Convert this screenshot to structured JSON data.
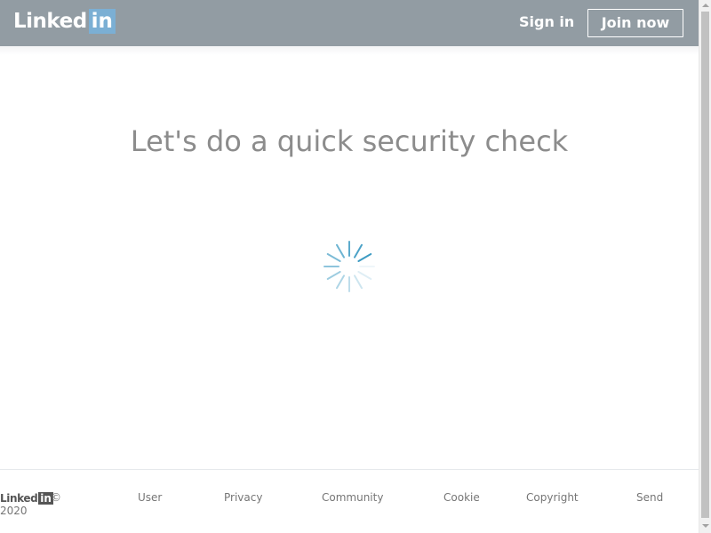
{
  "header": {
    "logo_word": "Linked",
    "logo_box": "in",
    "sign_in_label": "Sign in",
    "join_now_label": "Join now",
    "background_color": "#929ca3"
  },
  "main": {
    "title": "Let's do a quick security check",
    "spinner_icon": "loading-spinner-icon",
    "spinner_color": "#3d9bc3"
  },
  "footer": {
    "logo_word": "Linked",
    "logo_box": "in",
    "copyright_mark": "©",
    "year": "2020",
    "links": [
      "User",
      "Privacy",
      "Community",
      "Cookie",
      "Copyright",
      "Send"
    ]
  }
}
